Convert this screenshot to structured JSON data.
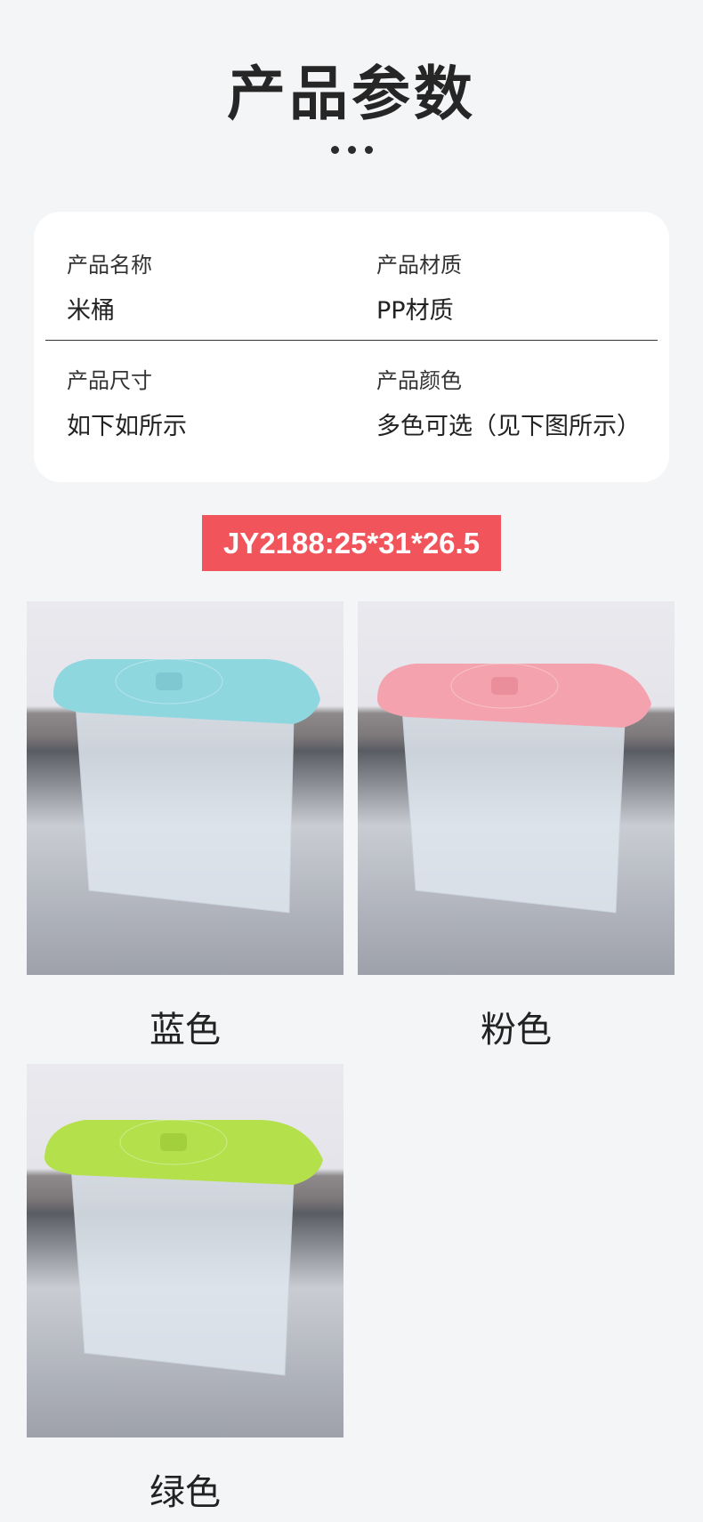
{
  "header": {
    "title": "产品参数"
  },
  "specs": [
    {
      "label": "产品名称",
      "value": "米桶"
    },
    {
      "label": "产品材质",
      "value": "PP材质"
    },
    {
      "label": "产品尺寸",
      "value": "如下如所示"
    },
    {
      "label": "产品颜色",
      "value": "多色可选（见下图所示）"
    }
  ],
  "model_tag": "JY2188:25*31*26.5",
  "products": [
    {
      "caption": "蓝色",
      "lid_color": "#8fd7df"
    },
    {
      "caption": "粉色",
      "lid_color": "#f3a2ae"
    },
    {
      "caption": "绿色",
      "lid_color": "#b4e04c"
    }
  ]
}
